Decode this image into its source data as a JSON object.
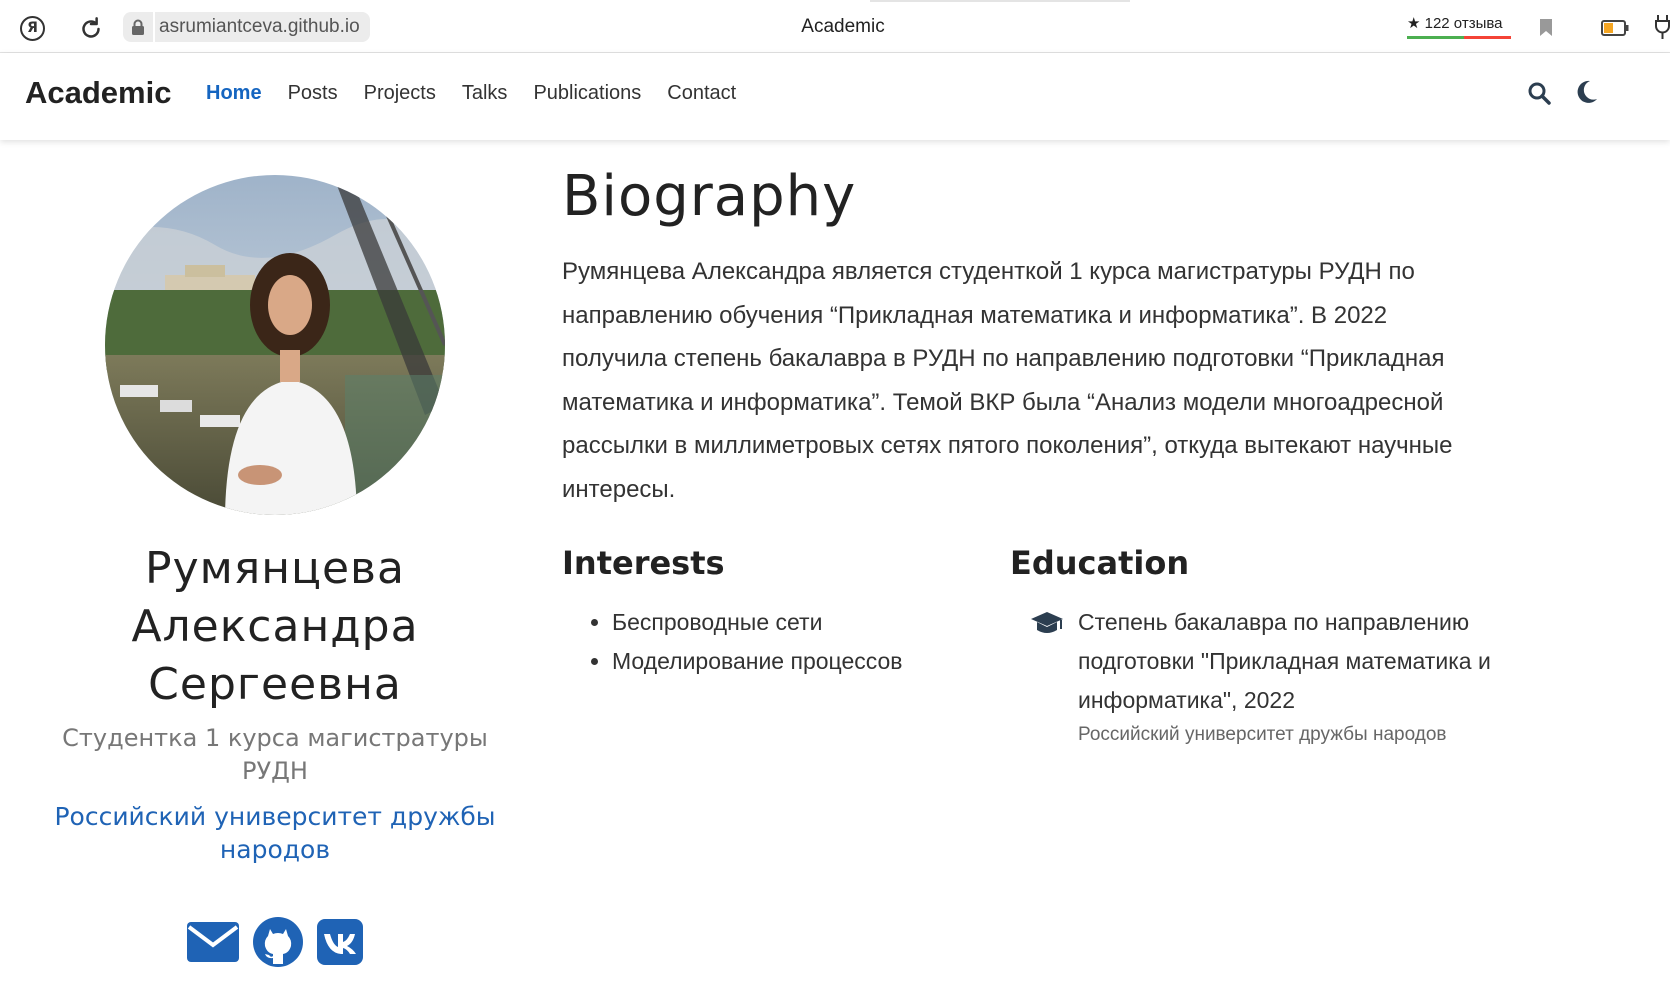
{
  "browser": {
    "url": "asrumiantceva.github.io",
    "tab_title": "Academic",
    "reviews": "★ 122 отзыва"
  },
  "navbar": {
    "brand": "Academic",
    "links": [
      "Home",
      "Posts",
      "Projects",
      "Talks",
      "Publications",
      "Contact"
    ],
    "active": "Home",
    "accent_color": "#1565c0"
  },
  "profile": {
    "name_lines": [
      "Румянцева",
      "Александра",
      "Сергеевна"
    ],
    "role_lines": [
      "Студентка 1 курса магистратуры",
      "РУДН"
    ],
    "org_lines": [
      "Российский университет дружбы",
      "народов"
    ],
    "socials": [
      "envelope-icon",
      "github-icon",
      "vk-icon"
    ],
    "social_color": "#1f63b5"
  },
  "biography": {
    "title": "Biography",
    "lines": [
      "Румянцева Александра является студенткой 1 курса магистратуры РУДН по",
      "направлению обучения “Прикладная математика и информатика”. В 2022",
      "получила степень бакалавра в РУДН по направлению подготовки “Прикладная",
      "математика и информатика”. Темой ВКР была “Анализ модели многоадресной",
      "рассылки в миллиметровых сетях пятого поколения”, откуда вытекают научные",
      "интересы."
    ]
  },
  "interests": {
    "title": "Interests",
    "items": [
      "Беспроводные сети",
      "Моделирование процессов"
    ]
  },
  "education": {
    "title": "Education",
    "course_lines": [
      "Степень бакалавра по направлению",
      "подготовки \"Прикладная математика и",
      "информатика\", 2022"
    ],
    "institution": "Российский университет дружбы народов"
  }
}
